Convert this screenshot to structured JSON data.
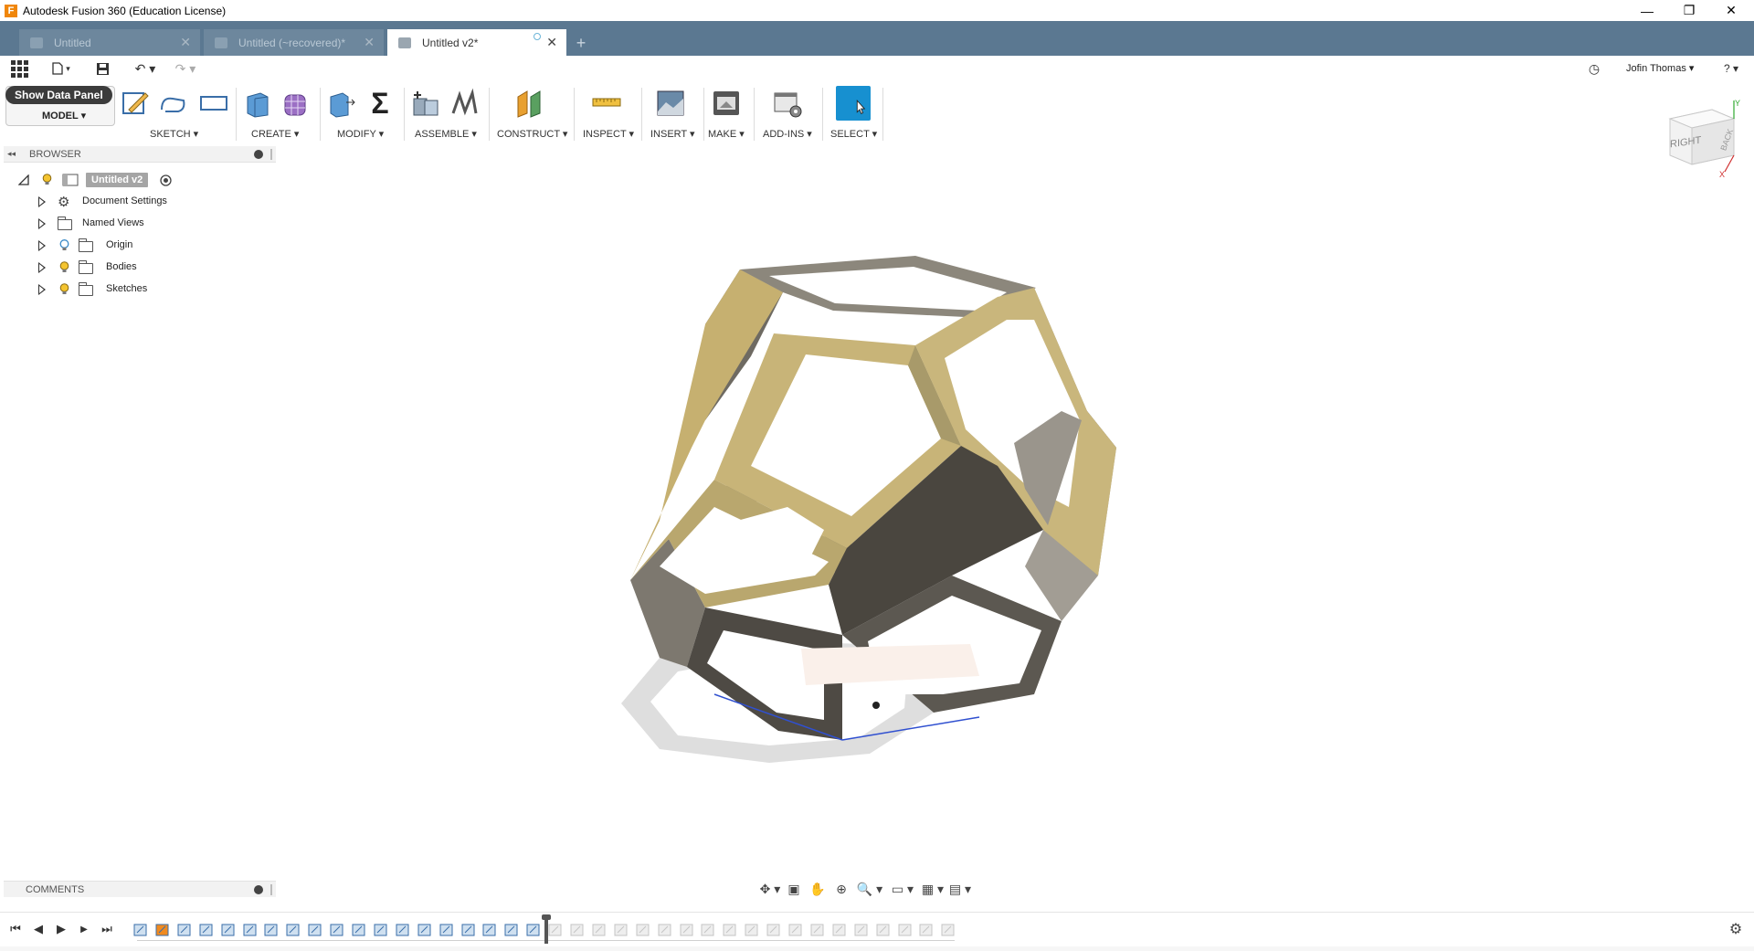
{
  "window": {
    "title": "Autodesk Fusion 360 (Education License)",
    "minimize_glyph": "—",
    "restore_glyph": "❐",
    "close_glyph": "✕"
  },
  "tabs": [
    {
      "label": "Untitled",
      "active": false
    },
    {
      "label": "Untitled (~recovered)*",
      "active": false
    },
    {
      "label": "Untitled v2*",
      "active": true
    }
  ],
  "tab_close_glyph": "✕",
  "new_tab_glyph": "+",
  "quick_access": {
    "user_name": "Jofin Thomas ▾",
    "history_glyph": "◷",
    "help_glyph": "? ▾",
    "file_glyph": "▾",
    "save_glyph": "💾",
    "undo_glyph": "↶ ▾",
    "redo_glyph": "↷ ▾"
  },
  "toolbar": {
    "show_data_panel": "Show Data Panel",
    "workspace": "MODEL ▾",
    "groups": [
      {
        "label": "SKETCH ▾"
      },
      {
        "label": "CREATE ▾"
      },
      {
        "label": "MODIFY ▾"
      },
      {
        "label": "ASSEMBLE ▾"
      },
      {
        "label": "CONSTRUCT ▾"
      },
      {
        "label": "INSPECT ▾"
      },
      {
        "label": "INSERT ▾"
      },
      {
        "label": "MAKE ▾"
      },
      {
        "label": "ADD-INS ▾"
      },
      {
        "label": "SELECT ▾"
      }
    ],
    "sigma_glyph": "Σ"
  },
  "browser": {
    "title": "BROWSER",
    "collapse_glyph": "◂◂",
    "root": "Untitled v2",
    "items": [
      {
        "label": "Document Settings"
      },
      {
        "label": "Named Views"
      },
      {
        "label": "Origin"
      },
      {
        "label": "Bodies"
      },
      {
        "label": "Sketches"
      }
    ]
  },
  "viewcube": {
    "right": "RIGHT",
    "back": "BACK",
    "axis_x": "X",
    "axis_y": "Y"
  },
  "comments": {
    "title": "COMMENTS"
  },
  "navbar": {
    "glyphs": [
      "✥ ▾",
      "▣",
      "✋",
      "⊕",
      "🔍 ▾",
      "▭ ▾",
      "▦ ▾",
      "▤ ▾"
    ]
  },
  "timeline": {
    "first_glyph": "⏮",
    "prev_glyph": "◀",
    "play_glyph": "▶",
    "next_glyph": "▶",
    "last_glyph": "⏭",
    "settings_glyph": "⚙"
  },
  "colors": {
    "tab_bar": "#5b7891",
    "select_blue": "#1790d0",
    "frame_gold": "#c8b478",
    "frame_gray": "#8e8a80"
  }
}
